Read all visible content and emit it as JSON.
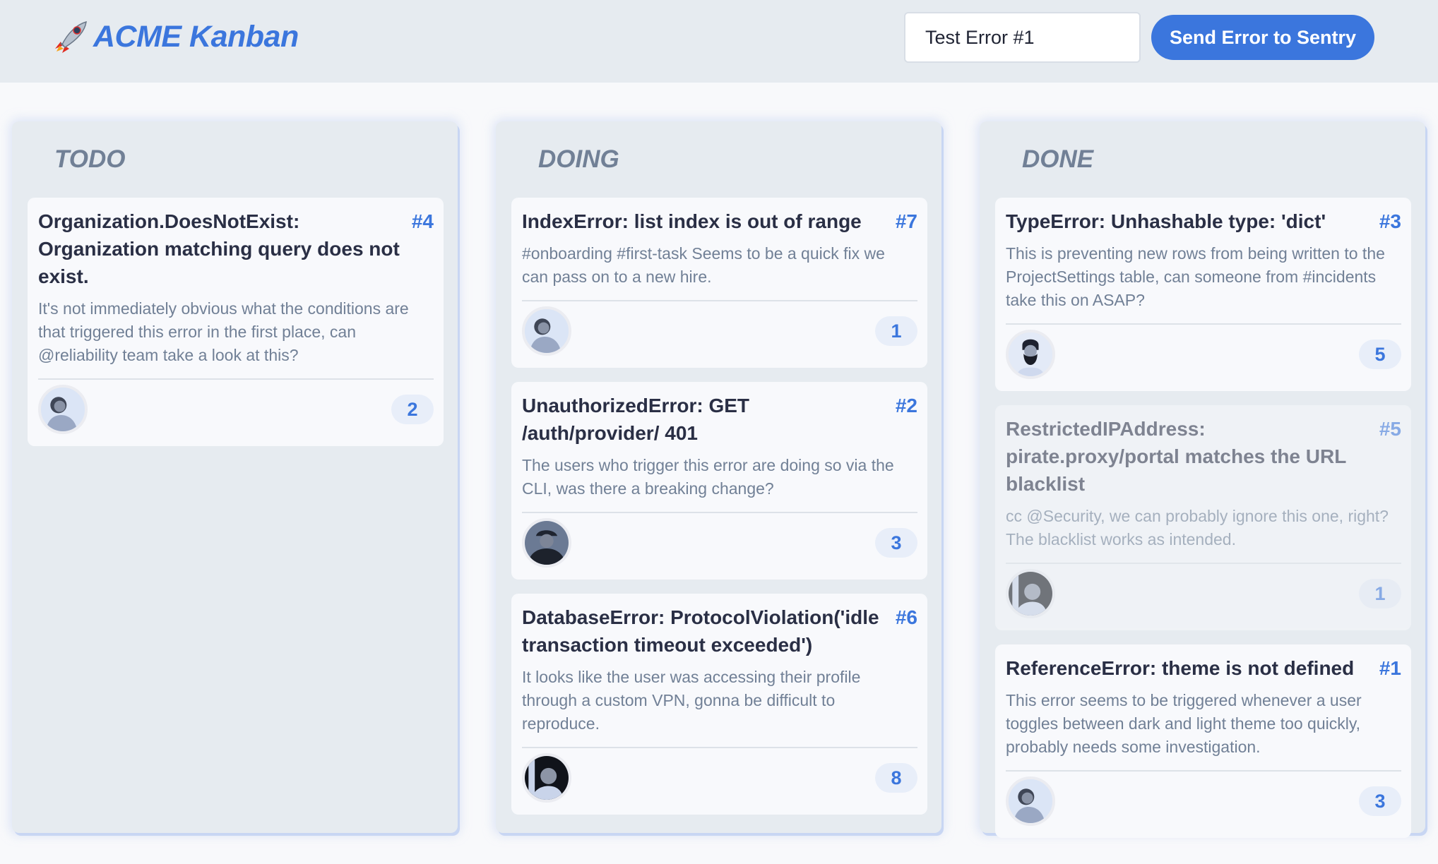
{
  "header": {
    "logo_icon": "rocket-icon",
    "title": "ACME Kanban",
    "error_input": {
      "value": "Test Error #1",
      "placeholder": ""
    },
    "send_button_label": "Send Error to Sentry"
  },
  "colors": {
    "accent": "#3b76dd",
    "header_bg": "#e6ebf0",
    "column_bg": "#e6ebf0",
    "card_bg": "#f8f9fc",
    "title_text": "#2a2f45",
    "muted_text": "#718096"
  },
  "columns": [
    {
      "title": "TODO",
      "cards": [
        {
          "title": "Organization.DoesNotExist: Organization matching query does not exist.",
          "number": "#4",
          "description": "It's not immediately obvious what the conditions are that triggered this error in the first place, can @reliability team take a look at this?",
          "avatar": "woman-avatar",
          "count": "2",
          "faded": false
        }
      ]
    },
    {
      "title": "DOING",
      "cards": [
        {
          "title": "IndexError: list index is out of range",
          "number": "#7",
          "description": "#onboarding #first-task Seems to be a quick fix we can pass on to a new hire.",
          "avatar": "woman-avatar",
          "count": "1",
          "faded": false
        },
        {
          "title": "UnauthorizedError: GET /auth/provider/ 401",
          "number": "#2",
          "description": "The users who trigger this error are doing so via the CLI, was there a breaking change?",
          "avatar": "cap-man-avatar",
          "count": "3",
          "faded": false
        },
        {
          "title": "DatabaseError: ProtocolViolation('idle transaction timeout exceeded')",
          "number": "#6",
          "description": "It looks like the user was accessing their profile through a custom VPN, gonna be difficult to reproduce.",
          "avatar": "man-avatar",
          "count": "8",
          "faded": false
        }
      ]
    },
    {
      "title": "DONE",
      "cards": [
        {
          "title": "TypeError: Unhashable type: 'dict'",
          "number": "#3",
          "description": "This is preventing new rows from being written to the ProjectSettings table, can someone from #incidents take this on ASAP?",
          "avatar": "bearded-man-avatar",
          "count": "5",
          "faded": false
        },
        {
          "title": "RestrictedIPAddress: pirate.proxy/portal matches the URL blacklist",
          "number": "#5",
          "description": "cc @Security, we can probably ignore this one, right? The blacklist works as intended.",
          "avatar": "man-avatar",
          "count": "1",
          "faded": true
        },
        {
          "title": "ReferenceError: theme is not defined",
          "number": "#1",
          "description": "This error seems to be triggered whenever a user toggles between dark and light theme too quickly, probably needs some investigation.",
          "avatar": "woman-avatar",
          "count": "3",
          "faded": false
        }
      ]
    }
  ]
}
